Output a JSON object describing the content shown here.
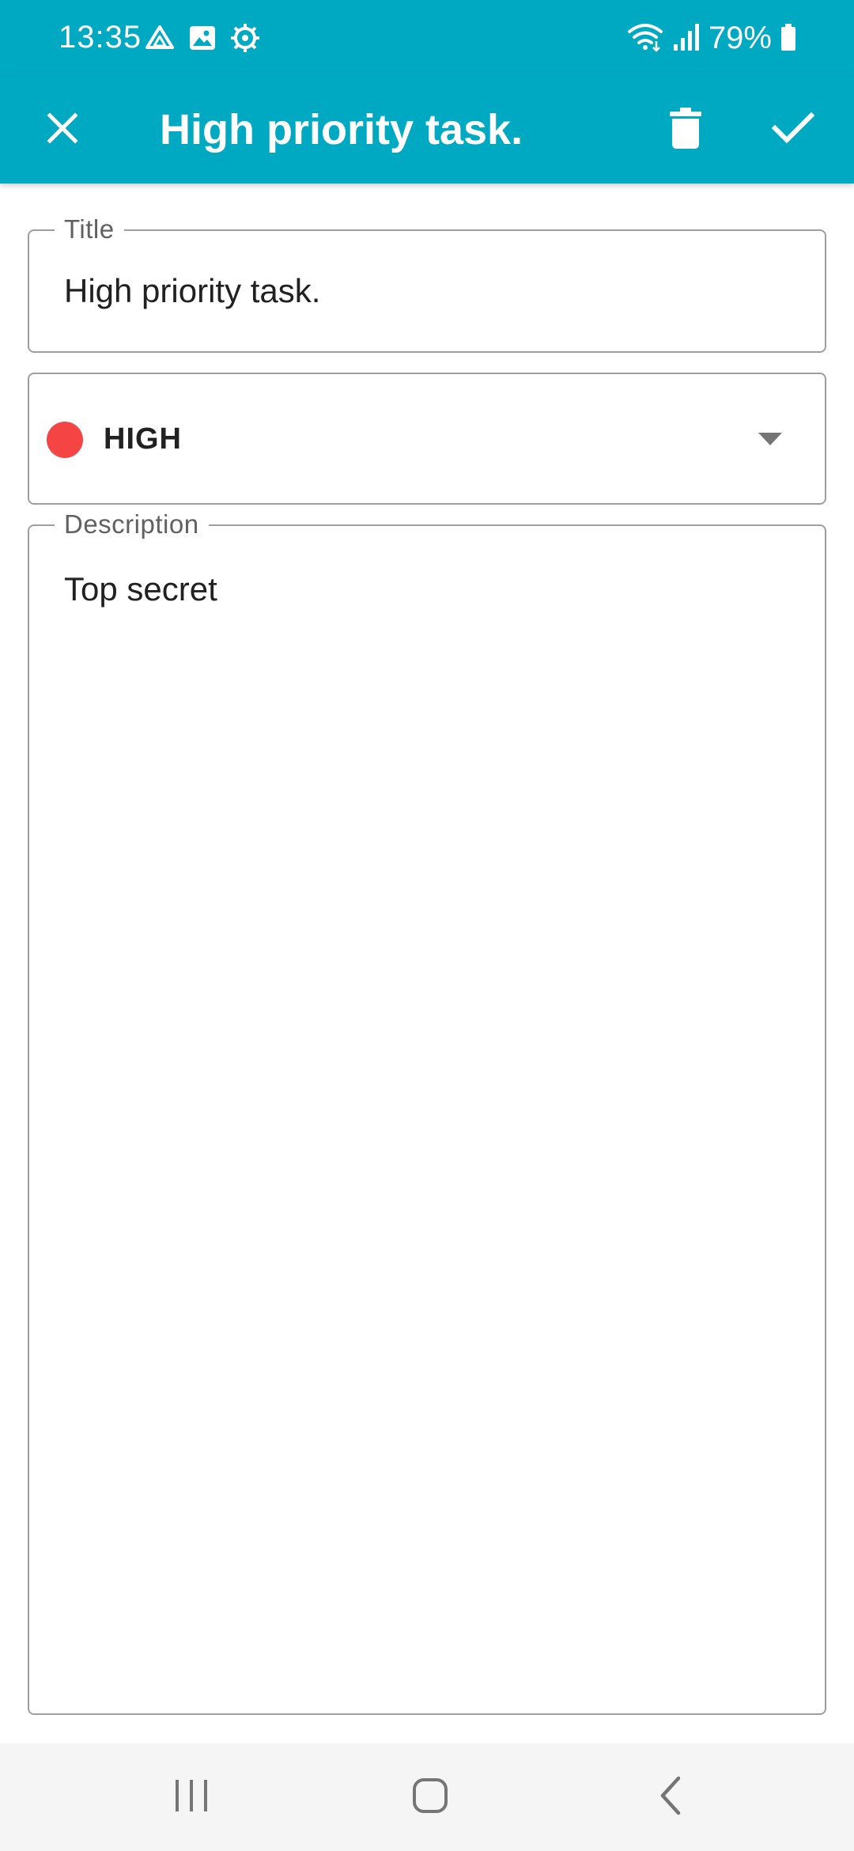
{
  "status_bar": {
    "time": "13:35",
    "battery_text": "79%",
    "left_icons": [
      "drive-icon",
      "gallery-icon",
      "settings-gear-icon"
    ],
    "right_icons": [
      "wifi-icon",
      "signal-icon",
      "battery-icon"
    ]
  },
  "app_bar": {
    "title": "High priority task.",
    "close_icon": "close-icon",
    "delete_icon": "trash-icon",
    "confirm_icon": "check-icon",
    "background_color": "#00a9c2"
  },
  "form": {
    "title_field": {
      "label": "Title",
      "value": "High priority task."
    },
    "priority_field": {
      "selected": "HIGH",
      "color": "#f44444"
    },
    "description_field": {
      "label": "Description",
      "value": "Top secret"
    }
  },
  "nav_bar": {
    "recents_icon": "recents-icon",
    "home_icon": "home-icon",
    "back_icon": "back-icon"
  }
}
